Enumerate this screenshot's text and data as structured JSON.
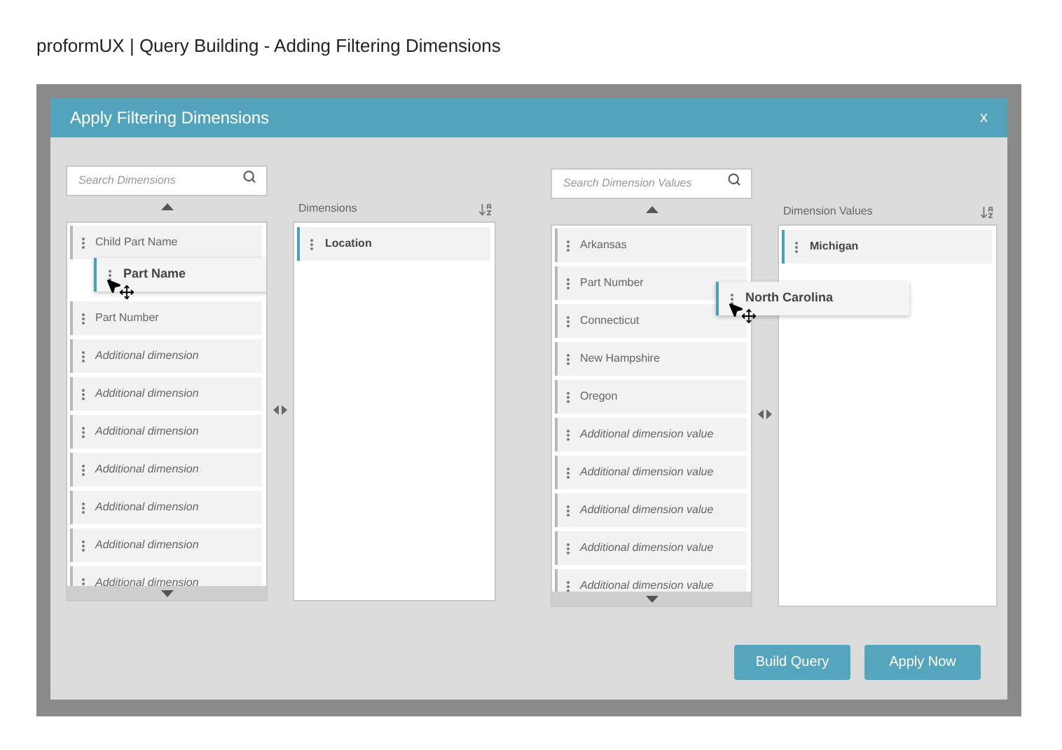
{
  "page_title": "proformUX | Query Building - Adding Filtering Dimensions",
  "dialog": {
    "title": "Apply Filtering Dimensions",
    "close": "x",
    "panels": [
      {
        "search_placeholder": "Search Dimensions",
        "selected_header": "Dimensions",
        "items": [
          {
            "label": "Child Part Name",
            "kind": "item",
            "dragging": false
          },
          {
            "label": "Part Name",
            "kind": "item",
            "dragging": true
          },
          {
            "label": "Part Number",
            "kind": "item",
            "dragging": false
          },
          {
            "label": "Additional dimension",
            "kind": "placeholder",
            "dragging": false
          },
          {
            "label": "Additional dimension",
            "kind": "placeholder",
            "dragging": false
          },
          {
            "label": "Additional dimension",
            "kind": "placeholder",
            "dragging": false
          },
          {
            "label": "Additional dimension",
            "kind": "placeholder",
            "dragging": false
          },
          {
            "label": "Additional dimension",
            "kind": "placeholder",
            "dragging": false
          },
          {
            "label": "Additional dimension",
            "kind": "placeholder",
            "dragging": false
          },
          {
            "label": "Additional dimension",
            "kind": "placeholder",
            "dragging": false
          }
        ],
        "selected": [
          {
            "label": "Location"
          }
        ]
      },
      {
        "search_placeholder": "Search Dimension Values",
        "selected_header": "Dimension Values",
        "items": [
          {
            "label": "Arkansas",
            "kind": "item",
            "dragging": false
          },
          {
            "label": "Part Number",
            "kind": "item",
            "dragging": false
          },
          {
            "label": "Connecticut",
            "kind": "item",
            "dragging": false
          },
          {
            "label": "New Hampshire",
            "kind": "item",
            "dragging": false
          },
          {
            "label": "Oregon",
            "kind": "item",
            "dragging": false
          },
          {
            "label": "Additional dimension value",
            "kind": "placeholder",
            "dragging": false
          },
          {
            "label": "Additional dimension value",
            "kind": "placeholder",
            "dragging": false
          },
          {
            "label": "Additional dimension value",
            "kind": "placeholder",
            "dragging": false
          },
          {
            "label": "Additional dimension value",
            "kind": "placeholder",
            "dragging": false
          },
          {
            "label": "Additional dimension value",
            "kind": "placeholder",
            "dragging": false
          }
        ],
        "selected": [
          {
            "label": "Michigan"
          }
        ],
        "dragged": {
          "label": "North Carolina"
        }
      }
    ],
    "buttons": [
      "Build Query",
      "Apply Now"
    ]
  }
}
